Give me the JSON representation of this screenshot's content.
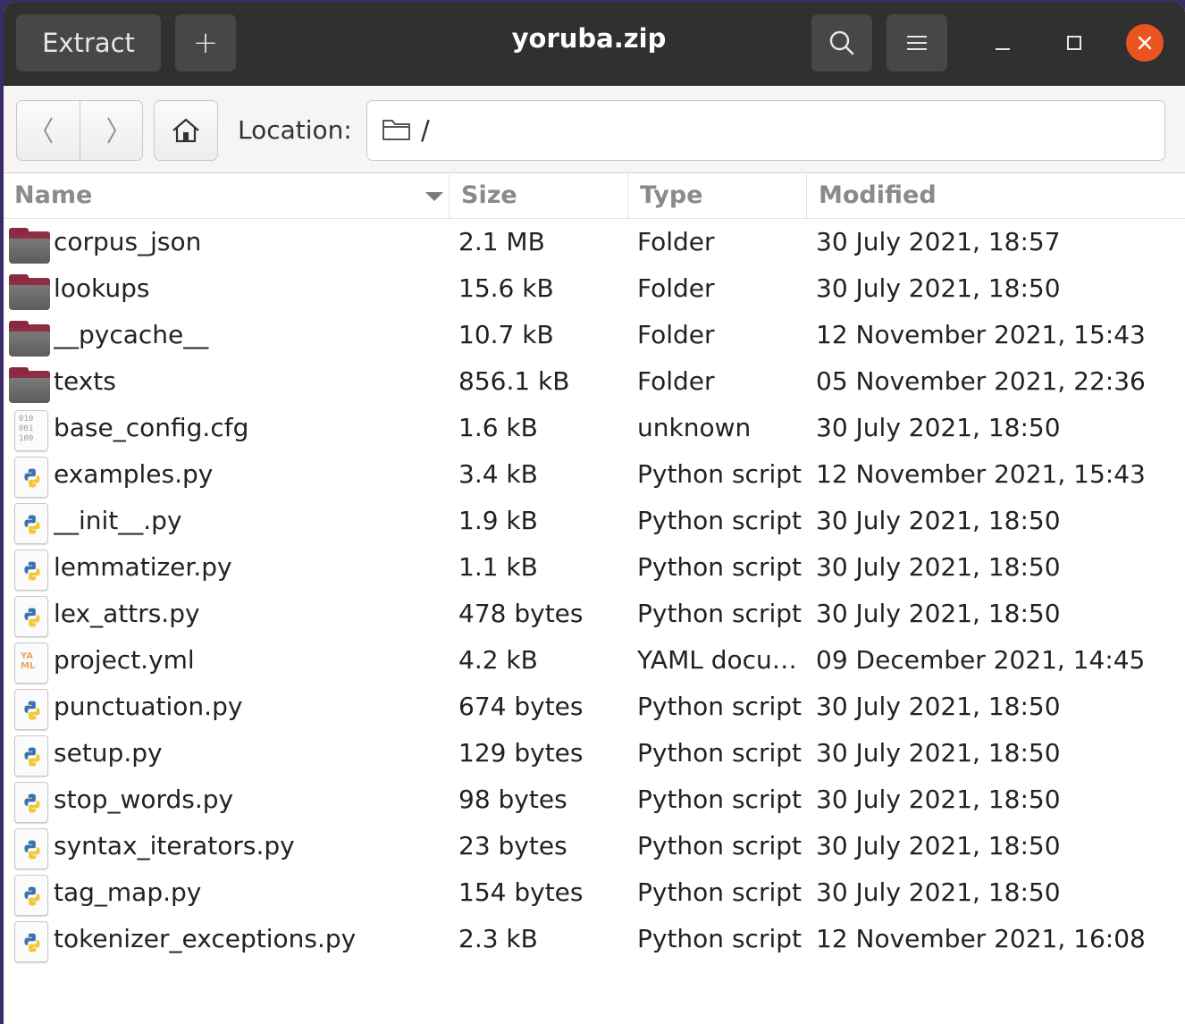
{
  "header": {
    "title": "yoruba.zip",
    "extract_label": "Extract",
    "add_label": "+"
  },
  "location": {
    "label": "Location:",
    "value": "/"
  },
  "columns": {
    "name": "Name",
    "size": "Size",
    "type": "Type",
    "modified": "Modified"
  },
  "files": [
    {
      "name": "corpus_json",
      "size": "2.1 MB",
      "type": "Folder",
      "modified": "30 July 2021, 18:57",
      "icon": "folder-icon"
    },
    {
      "name": "lookups",
      "size": "15.6 kB",
      "type": "Folder",
      "modified": "30 July 2021, 18:50",
      "icon": "folder-icon"
    },
    {
      "name": "__pycache__",
      "size": "10.7 kB",
      "type": "Folder",
      "modified": "12 November 2021, 15:43",
      "icon": "folder-icon"
    },
    {
      "name": "texts",
      "size": "856.1 kB",
      "type": "Folder",
      "modified": "05 November 2021, 22:36",
      "icon": "folder-icon"
    },
    {
      "name": "base_config.cfg",
      "size": "1.6 kB",
      "type": "unknown",
      "modified": "30 July 2021, 18:50",
      "icon": "binary-file-icon"
    },
    {
      "name": "examples.py",
      "size": "3.4 kB",
      "type": "Python script",
      "modified": "12 November 2021, 15:43",
      "icon": "python-file-icon"
    },
    {
      "name": "__init__.py",
      "size": "1.9 kB",
      "type": "Python script",
      "modified": "30 July 2021, 18:50",
      "icon": "python-file-icon"
    },
    {
      "name": "lemmatizer.py",
      "size": "1.1 kB",
      "type": "Python script",
      "modified": "30 July 2021, 18:50",
      "icon": "python-file-icon"
    },
    {
      "name": "lex_attrs.py",
      "size": "478 bytes",
      "type": "Python script",
      "modified": "30 July 2021, 18:50",
      "icon": "python-file-icon"
    },
    {
      "name": "project.yml",
      "size": "4.2 kB",
      "type": "YAML docu…",
      "modified": "09 December 2021, 14:45",
      "icon": "yaml-file-icon"
    },
    {
      "name": "punctuation.py",
      "size": "674 bytes",
      "type": "Python script",
      "modified": "30 July 2021, 18:50",
      "icon": "python-file-icon"
    },
    {
      "name": "setup.py",
      "size": "129 bytes",
      "type": "Python script",
      "modified": "30 July 2021, 18:50",
      "icon": "python-file-icon"
    },
    {
      "name": "stop_words.py",
      "size": "98 bytes",
      "type": "Python script",
      "modified": "30 July 2021, 18:50",
      "icon": "python-file-icon"
    },
    {
      "name": "syntax_iterators.py",
      "size": "23 bytes",
      "type": "Python script",
      "modified": "30 July 2021, 18:50",
      "icon": "python-file-icon"
    },
    {
      "name": "tag_map.py",
      "size": "154 bytes",
      "type": "Python script",
      "modified": "30 July 2021, 18:50",
      "icon": "python-file-icon"
    },
    {
      "name": "tokenizer_exceptions.py",
      "size": "2.3 kB",
      "type": "Python script",
      "modified": "12 November 2021, 16:08",
      "icon": "python-file-icon"
    }
  ],
  "icon_text": {
    "binary": "010\n001\n100",
    "yaml": "YA\nML"
  },
  "colors": {
    "headerbar": "#303030",
    "close_button": "#e95420",
    "folder": "#8e2f45"
  }
}
